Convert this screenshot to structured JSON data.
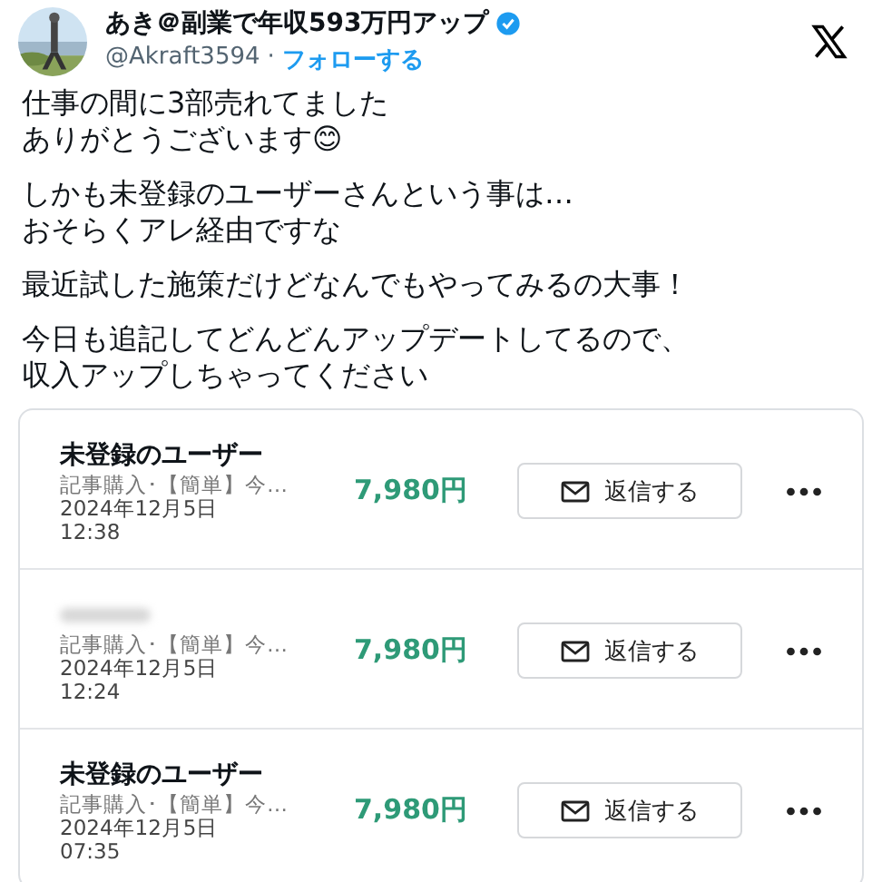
{
  "author": {
    "name": "あき＠副業で年収593万円アップ",
    "handle": "@Akraft3594",
    "separator": "·",
    "follow": "フォローする"
  },
  "paragraphs": [
    [
      "仕事の間に3部売れてました",
      "ありがとうございます😊"
    ],
    [
      "しかも未登録のユーザーさんという事は…",
      "おそらくアレ経由ですな"
    ],
    [
      "最近試した施策だけどなんでもやってみるの大事！"
    ],
    [
      "今日も追記してどんどんアップデートしてるので、",
      "収入アップしちゃってください"
    ]
  ],
  "sales": [
    {
      "name": "未登録のユーザー",
      "item": "記事購入･【簡単】今…",
      "date": "2024年12月5日",
      "time": "12:38",
      "price": "7,980円",
      "reply": "返信する"
    },
    {
      "item": "記事購入･【簡単】今…",
      "date": "2024年12月5日",
      "time": "12:24",
      "price": "7,980円",
      "reply": "返信する"
    },
    {
      "name": "未登録のユーザー",
      "item": "記事購入･【簡単】今…",
      "date": "2024年12月5日",
      "time": "07:35",
      "price": "7,980円",
      "reply": "返信する"
    }
  ]
}
